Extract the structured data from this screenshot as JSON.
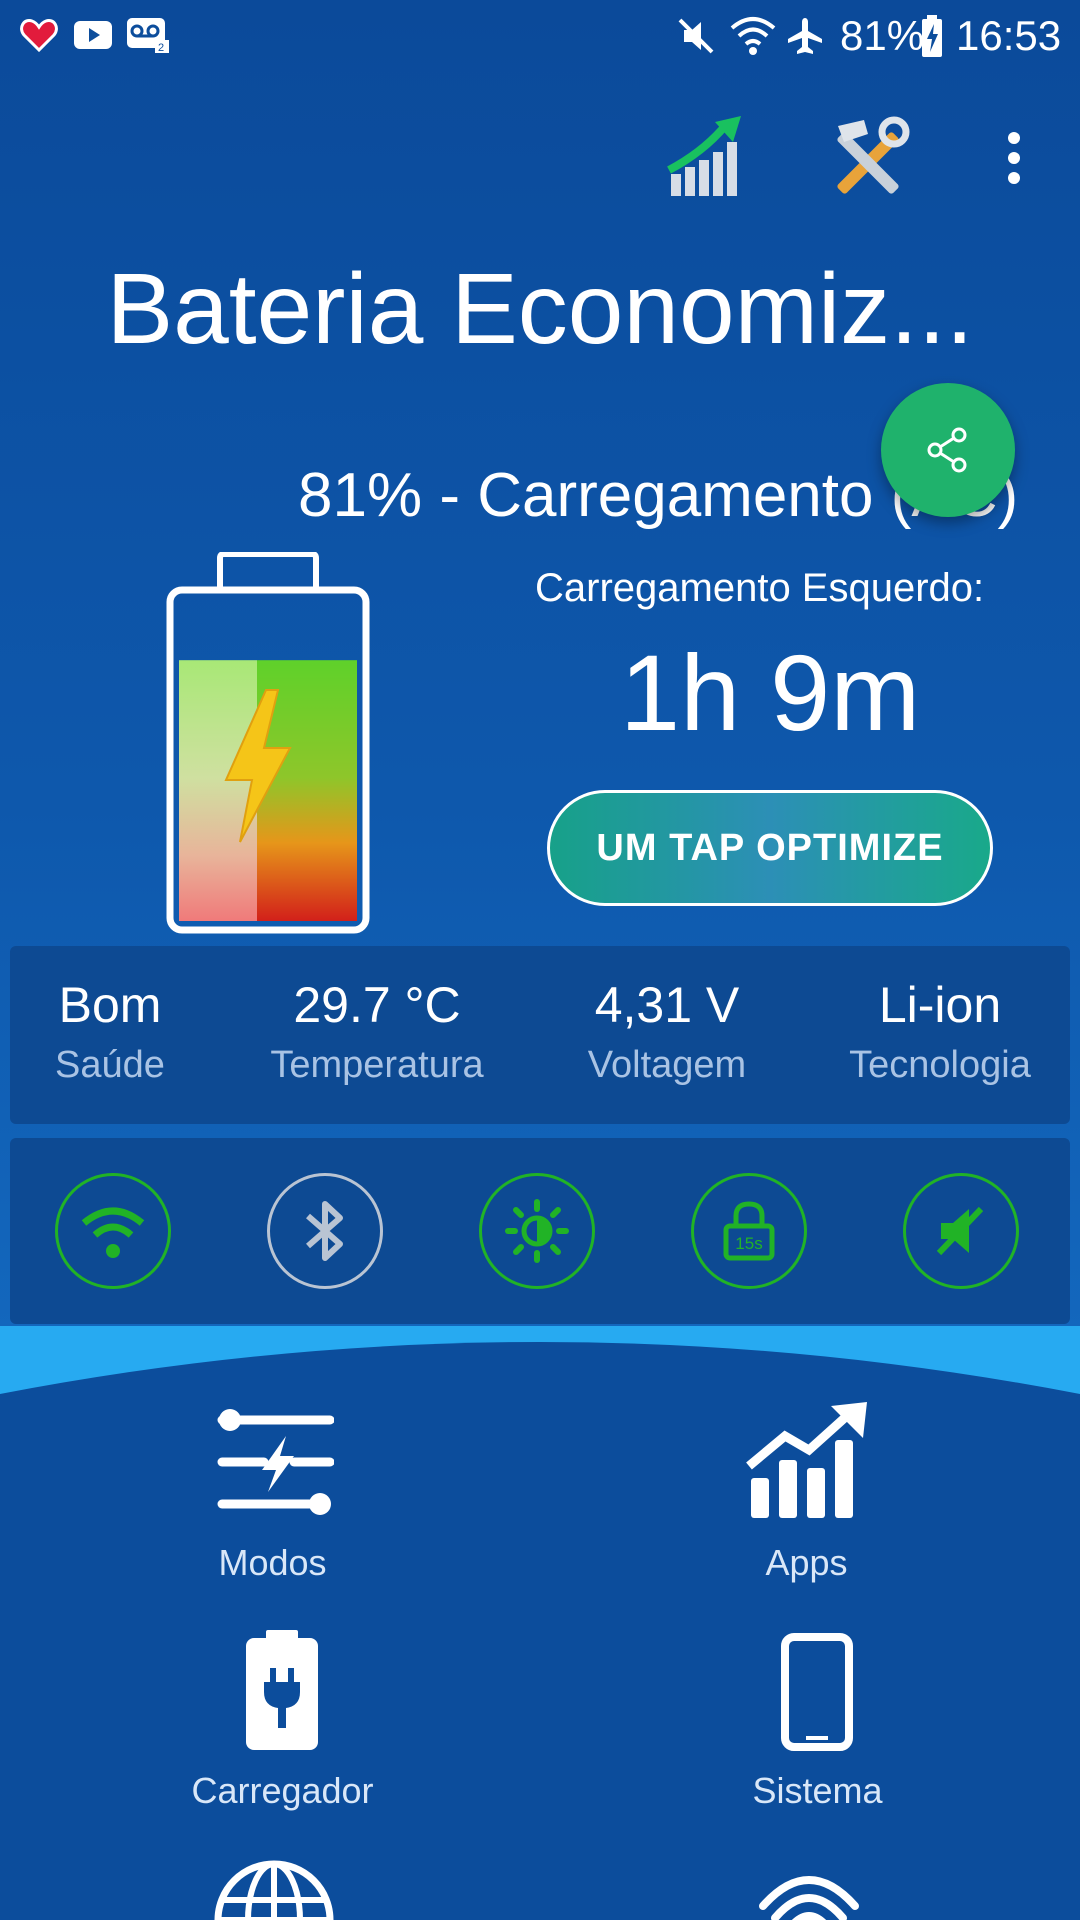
{
  "status_bar": {
    "battery_percent": "81%",
    "time": "16:53",
    "icons": [
      "heart-icon",
      "youtube-icon",
      "voicemail-icon",
      "mute-icon",
      "wifi-icon",
      "airplane-icon",
      "battery-charging-icon"
    ]
  },
  "toolbar": {
    "icons": [
      "signal-boost-icon",
      "tools-icon",
      "more-vert-icon"
    ]
  },
  "app": {
    "title": "Bateria Economiz..."
  },
  "battery": {
    "status_line": "81% - Carregamento (AC)",
    "level": 0.81,
    "remaining_label": "Carregamento Esquerdo:",
    "remaining_value": "1h 9m"
  },
  "actions": {
    "optimize_label": "UM TAP OPTIMIZE",
    "share_icon": "share-icon"
  },
  "info": [
    {
      "value": "Bom",
      "label": "Saúde"
    },
    {
      "value": "29.7 °C",
      "label": "Temperatura"
    },
    {
      "value": "4,31 V",
      "label": "Voltagem"
    },
    {
      "value": "Li-ion",
      "label": "Tecnologia"
    }
  ],
  "toggles": [
    {
      "name": "wifi-toggle",
      "icon": "wifi-icon",
      "state": "on"
    },
    {
      "name": "bluetooth-toggle",
      "icon": "bluetooth-icon",
      "state": "off"
    },
    {
      "name": "brightness-toggle",
      "icon": "brightness-icon",
      "state": "on"
    },
    {
      "name": "screen-timeout-toggle",
      "icon": "lock-timeout-icon",
      "state": "on",
      "badge": "15s"
    },
    {
      "name": "sound-toggle",
      "icon": "mute-icon",
      "state": "on"
    }
  ],
  "menu": [
    {
      "label": "Modos",
      "icon": "sliders-icon"
    },
    {
      "label": "Apps",
      "icon": "chart-up-icon"
    },
    {
      "label": "Carregador",
      "icon": "charger-icon"
    },
    {
      "label": "Sistema",
      "icon": "phone-icon"
    },
    {
      "label": "",
      "icon": "globe-icon"
    },
    {
      "label": "",
      "icon": "fingerprint-icon"
    }
  ],
  "colors": {
    "accent_green": "#21b326",
    "fab_green": "#1fb26c",
    "background": "#0c4d9c"
  }
}
